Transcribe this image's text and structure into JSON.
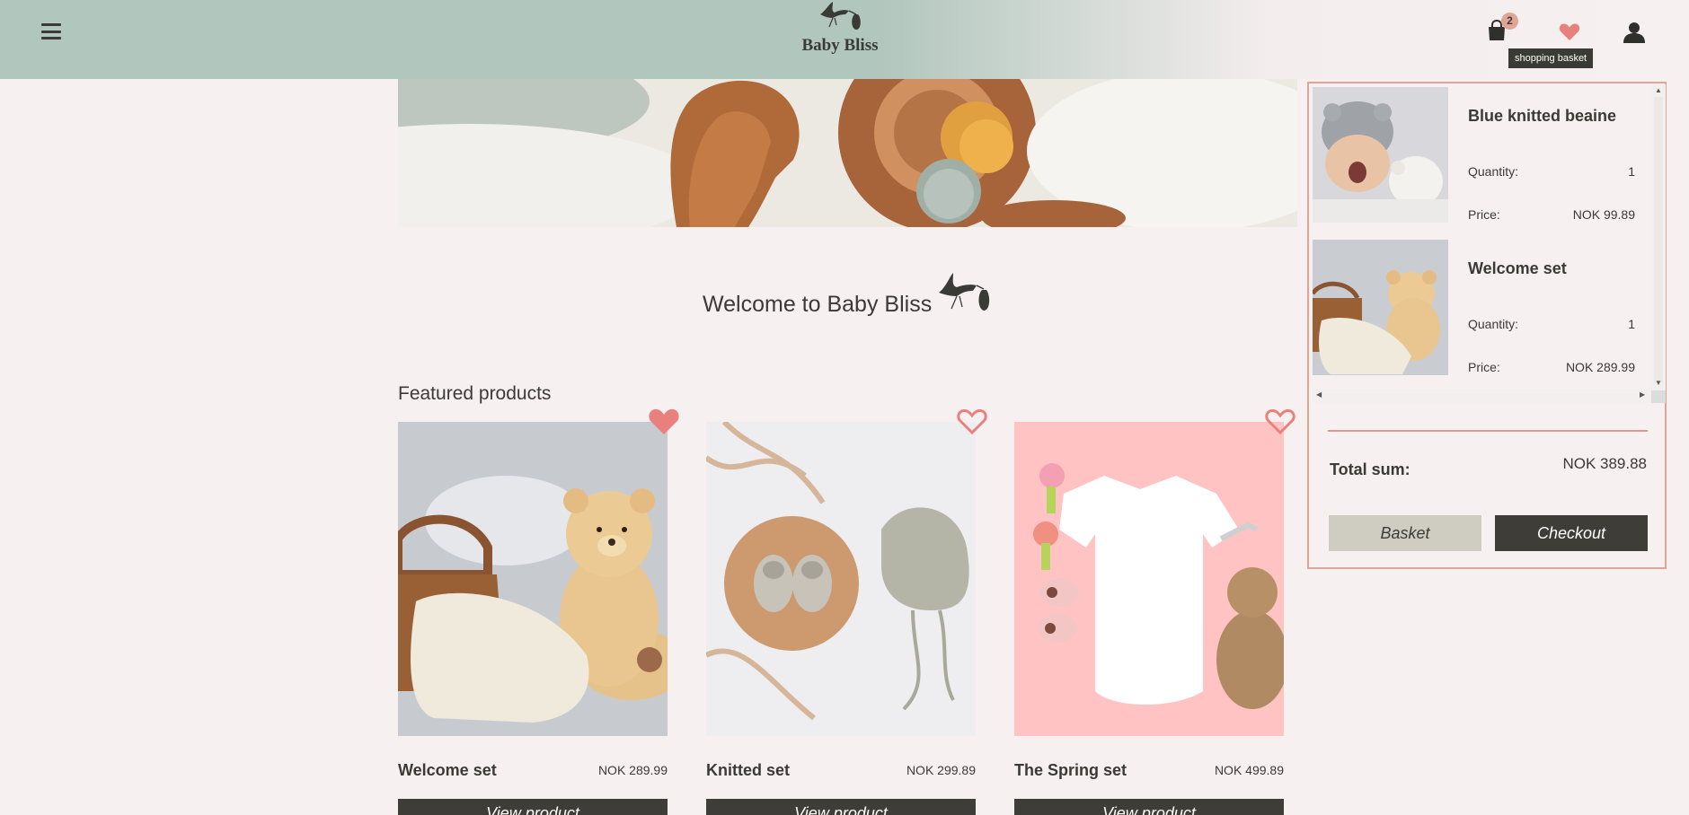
{
  "header": {
    "brand": "Baby Bliss",
    "basket_count": "2",
    "tooltip": "shopping basket",
    "icons": [
      "menu-icon",
      "stork-logo-icon",
      "shopping-bag-icon",
      "heart-icon",
      "user-icon"
    ]
  },
  "main": {
    "welcome": "Welcome to Baby Bliss",
    "featured_title": "Featured products",
    "products": [
      {
        "name": "Welcome set",
        "price": "NOK 289.99",
        "button": "View product",
        "favorited": true
      },
      {
        "name": "Knitted set",
        "price": "NOK 299.89",
        "button": "View product",
        "favorited": false
      },
      {
        "name": "The Spring set",
        "price": "NOK 499.89",
        "button": "View product",
        "favorited": false
      }
    ]
  },
  "cart": {
    "items": [
      {
        "name": "Blue knitted beaine",
        "qty_label": "Quantity:",
        "qty": "1",
        "price_label": "Price:",
        "price": "NOK 99.89"
      },
      {
        "name": "Welcome set",
        "qty_label": "Quantity:",
        "qty": "1",
        "price_label": "Price:",
        "price": "NOK 289.99"
      }
    ],
    "total_label": "Total sum:",
    "total_value": "NOK 389.88",
    "basket_button": "Basket",
    "checkout_button": "Checkout"
  },
  "colors": {
    "header_bg": "#b1c6bd",
    "accent": "#e1a596",
    "dark": "#3f3d38",
    "page_bg": "#f6f0f0",
    "heart": "#e8817e"
  }
}
